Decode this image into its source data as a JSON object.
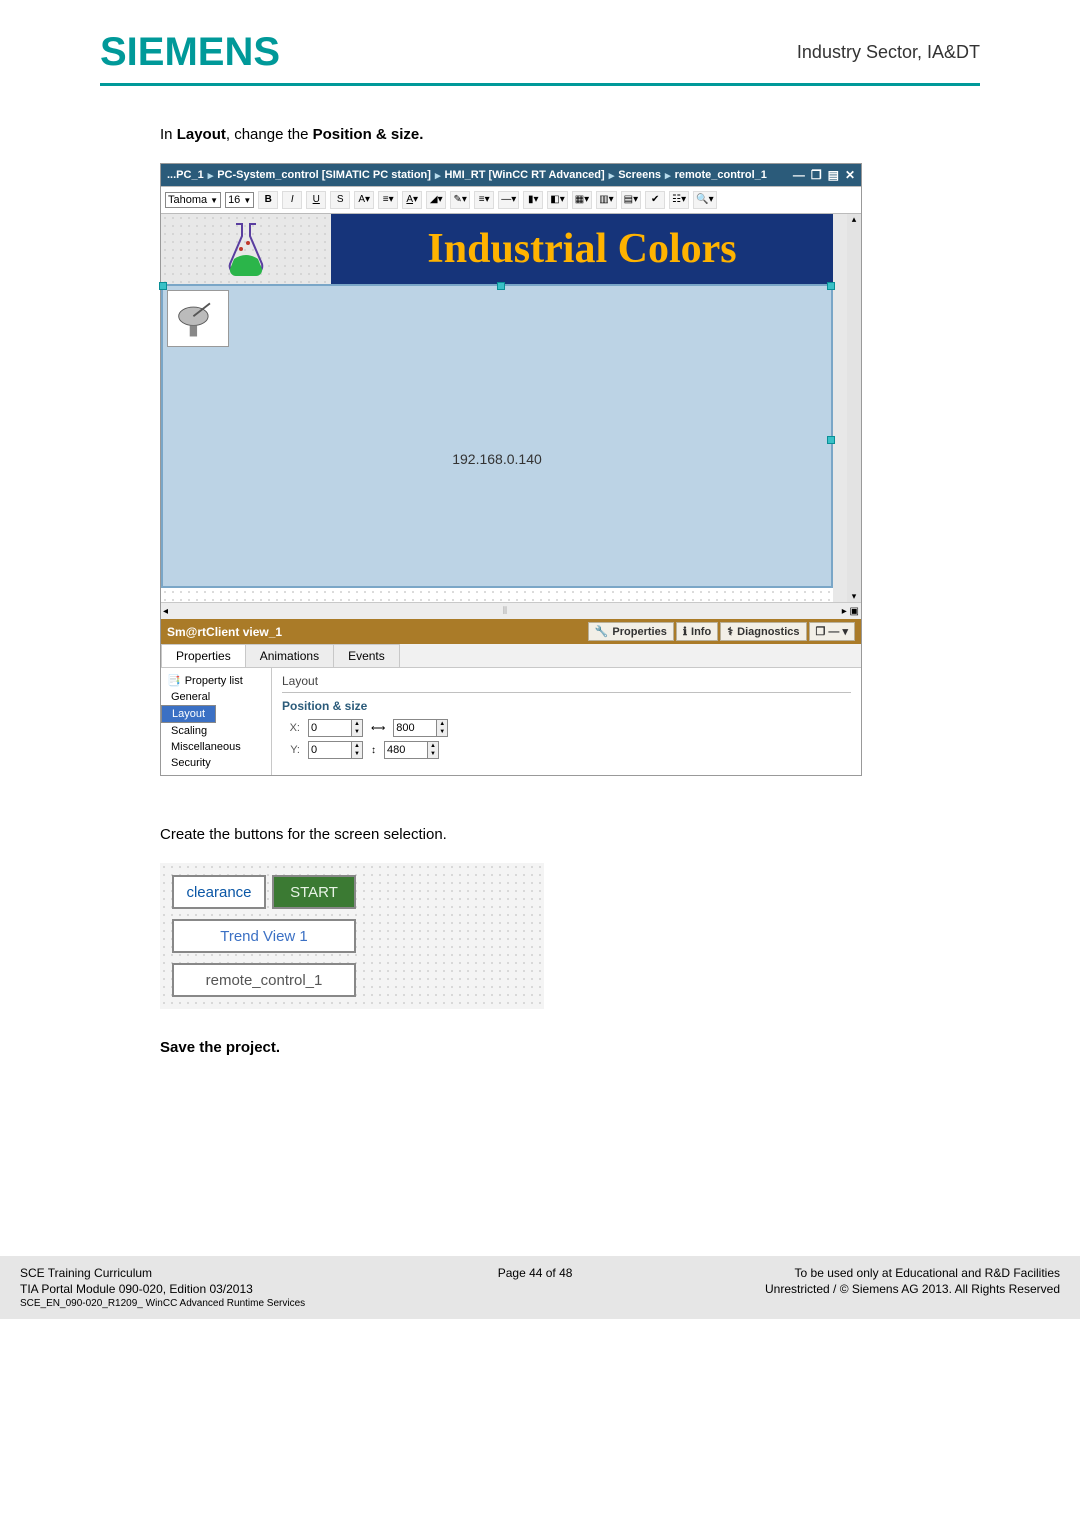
{
  "header": {
    "logo": "SIEMENS",
    "right": "Industry Sector, IA&DT"
  },
  "body": {
    "para1_prefix": "In ",
    "para1_b1": "Layout",
    "para1_mid": ", change the ",
    "para1_b2": "Position & size.",
    "para2": "Create the buttons for the screen selection.",
    "para3": "Save the project."
  },
  "editor": {
    "crumbs": [
      "...PC_1",
      "PC-System_control [SIMATIC PC station]",
      "HMI_RT [WinCC RT Advanced]",
      "Screens",
      "remote_control_1"
    ],
    "font": "Tahoma",
    "fontsize": "16",
    "ind_title": "Industrial Colors",
    "ip": "192.168.0.140",
    "obj_name": "Sm@rtClient view_1",
    "inspector_tabs": [
      "Properties",
      "Info",
      "Diagnostics"
    ],
    "prop_tabs": [
      "Properties",
      "Animations",
      "Events"
    ],
    "nav_header": "Property list",
    "nav_items": [
      "General",
      "Layout",
      "Scaling",
      "Miscellaneous",
      "Security"
    ],
    "nav_selected": "Layout",
    "section_title": "Layout",
    "subsection": "Position & size",
    "x_label": "X:",
    "y_label": "Y:",
    "x_val": "0",
    "y_val": "0",
    "w_val": "800",
    "h_val": "480"
  },
  "buttons_shot": {
    "b1": "clearance",
    "b2": "START",
    "b3": "Trend View 1",
    "b4": "remote_control_1"
  },
  "footer": {
    "l1": "SCE Training Curriculum",
    "l2": "TIA Portal Module 090-020, Edition 03/2013",
    "l3": "SCE_EN_090-020_R1209_ WinCC Advanced Runtime Services",
    "c1": "Page 44 of 48",
    "r1": "To be used only at Educational and R&D Facilities",
    "r2": "Unrestricted / © Siemens AG 2013. All Rights Reserved"
  }
}
